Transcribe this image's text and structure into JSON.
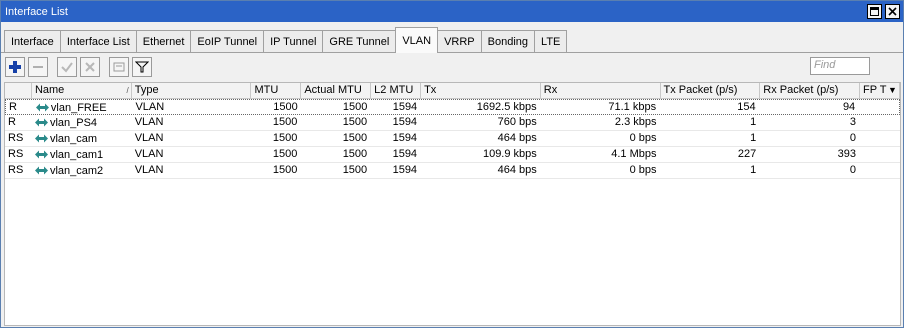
{
  "window": {
    "title": "Interface List"
  },
  "tabs": [
    "Interface",
    "Interface List",
    "Ethernet",
    "EoIP Tunnel",
    "IP Tunnel",
    "GRE Tunnel",
    "VLAN",
    "VRRP",
    "Bonding",
    "LTE"
  ],
  "active_tab": "VLAN",
  "toolbar": {
    "find_placeholder": "Find"
  },
  "columns": [
    "",
    "Name",
    "Type",
    "MTU",
    "Actual MTU",
    "L2 MTU",
    "Tx",
    "Rx",
    "Tx Packet (p/s)",
    "Rx Packet (p/s)",
    "FP T"
  ],
  "rows": [
    {
      "flag": "R",
      "name": "vlan_FREE",
      "type": "VLAN",
      "mtu": "1500",
      "actual_mtu": "1500",
      "l2_mtu": "1594",
      "tx": "1692.5 kbps",
      "rx": "71.1 kbps",
      "tx_pps": "154",
      "rx_pps": "94"
    },
    {
      "flag": "R",
      "name": "vlan_PS4",
      "type": "VLAN",
      "mtu": "1500",
      "actual_mtu": "1500",
      "l2_mtu": "1594",
      "tx": "760 bps",
      "rx": "2.3 kbps",
      "tx_pps": "1",
      "rx_pps": "3"
    },
    {
      "flag": "RS",
      "name": "vlan_cam",
      "type": "VLAN",
      "mtu": "1500",
      "actual_mtu": "1500",
      "l2_mtu": "1594",
      "tx": "464 bps",
      "rx": "0 bps",
      "tx_pps": "1",
      "rx_pps": "0"
    },
    {
      "flag": "RS",
      "name": "vlan_cam1",
      "type": "VLAN",
      "mtu": "1500",
      "actual_mtu": "1500",
      "l2_mtu": "1594",
      "tx": "109.9 kbps",
      "rx": "4.1 Mbps",
      "tx_pps": "227",
      "rx_pps": "393"
    },
    {
      "flag": "RS",
      "name": "vlan_cam2",
      "type": "VLAN",
      "mtu": "1500",
      "actual_mtu": "1500",
      "l2_mtu": "1594",
      "tx": "464 bps",
      "rx": "0 bps",
      "tx_pps": "1",
      "rx_pps": "0"
    }
  ]
}
